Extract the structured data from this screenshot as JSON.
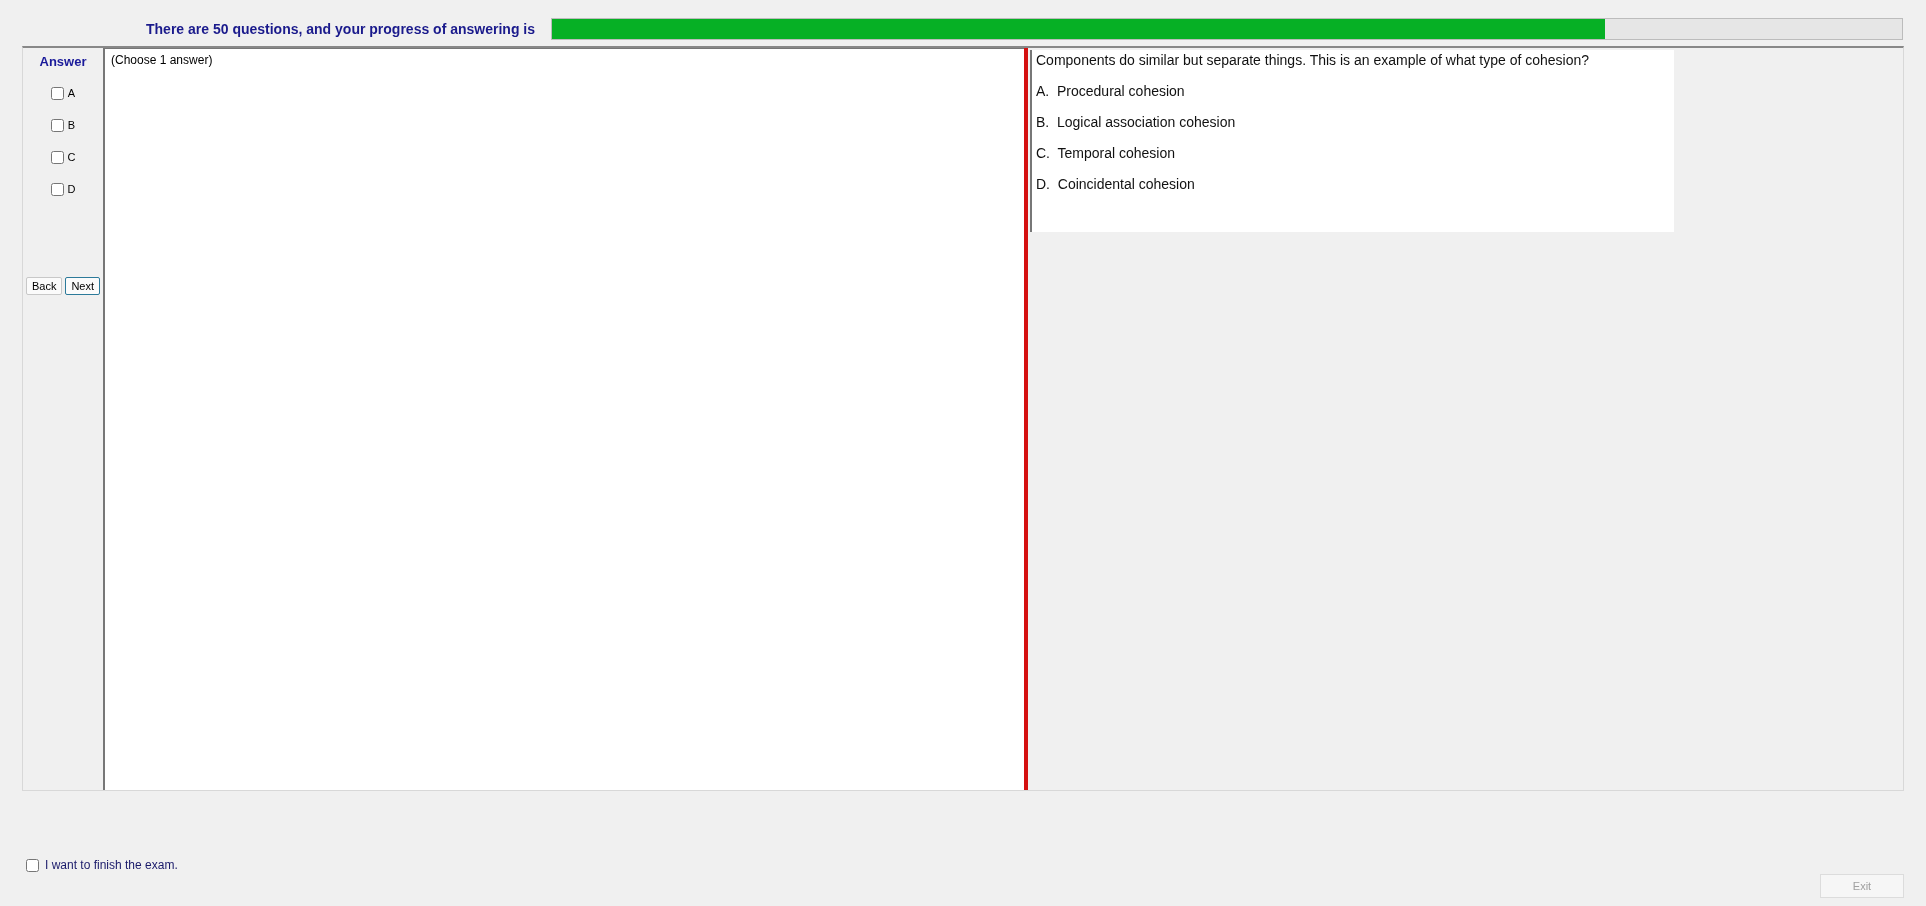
{
  "header": {
    "text": "There are 50 questions, and your progress of answering is",
    "progress": {
      "level": 0.78
    }
  },
  "answer_panel": {
    "title": "Answer",
    "options": [
      {
        "label": "A",
        "checked": false
      },
      {
        "label": "B",
        "checked": false
      },
      {
        "label": "C",
        "checked": false
      },
      {
        "label": "D",
        "checked": false
      }
    ],
    "buttons": [
      {
        "label": "Back",
        "selected": false
      },
      {
        "label": "Next",
        "selected": true
      }
    ]
  },
  "answer_text": {
    "value": "(Choose 1 answer)"
  },
  "question": {
    "text": "Components do similar but separate things. This is an example of what type of cohesion?",
    "choices": [
      {
        "letter": "A.",
        "text": "Procedural cohesion"
      },
      {
        "letter": "B.",
        "text": "Logical association cohesion"
      },
      {
        "letter": "C.",
        "text": "Temporal cohesion"
      },
      {
        "letter": "D.",
        "text": "Coincidental cohesion"
      }
    ]
  },
  "finish": {
    "label": "I want to finish the exam.",
    "checked": false
  },
  "exit_button": {
    "label": "Exit",
    "disabled": true
  }
}
